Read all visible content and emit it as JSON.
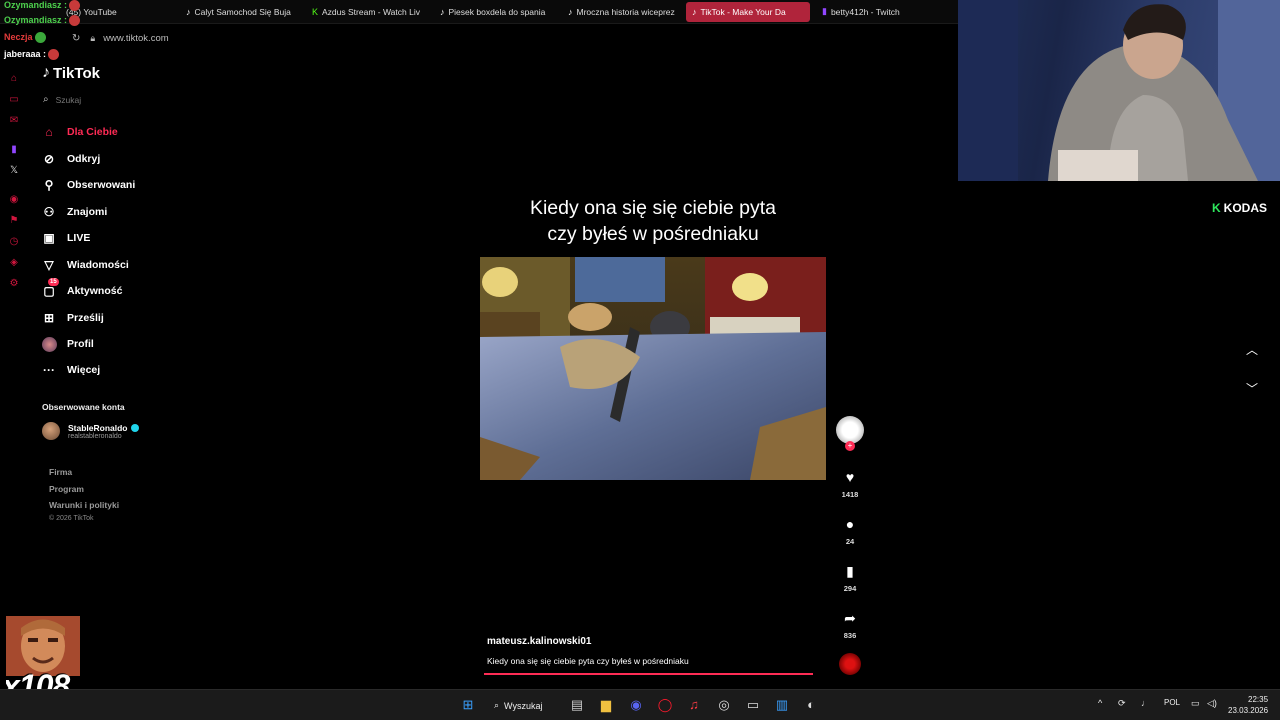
{
  "browser": {
    "tabs": [
      {
        "label": "(45) YouTube",
        "active": false
      },
      {
        "label": "Calyt Samochod Się Buja",
        "active": false
      },
      {
        "label": "Azdus Stream - Watch Liv",
        "active": false
      },
      {
        "label": "Piesek boxdela do spania",
        "active": false
      },
      {
        "label": "Mroczna historia wiceprez",
        "active": false
      },
      {
        "label": "TikTok - Make Your Da",
        "active": true
      },
      {
        "label": "betty412h - Twitch",
        "active": false
      }
    ],
    "url": "www.tiktok.com"
  },
  "chat_overlay": {
    "lines": [
      {
        "user": "Ozymandiasz :",
        "color": "#4dd04d"
      },
      {
        "user": "Ozymandiasz :",
        "color": "#4dd04d"
      },
      {
        "user": "Neczja",
        "color": "#e33c3c"
      },
      {
        "user": "jaberaaa :",
        "color": "#ffffff"
      }
    ]
  },
  "sidebar": {
    "logo": "TikTok",
    "search_placeholder": "Szukaj",
    "nav": [
      {
        "label": "Dla Ciebie",
        "icon": "home-icon",
        "active": true
      },
      {
        "label": "Odkryj",
        "icon": "compass-icon"
      },
      {
        "label": "Obserwowani",
        "icon": "following-icon"
      },
      {
        "label": "Znajomi",
        "icon": "friends-icon"
      },
      {
        "label": "LIVE",
        "icon": "live-icon"
      },
      {
        "label": "Wiadomości",
        "icon": "messages-icon"
      },
      {
        "label": "Aktywność",
        "icon": "activity-icon",
        "badge": "15"
      },
      {
        "label": "Prześlij",
        "icon": "upload-icon"
      },
      {
        "label": "Profil",
        "icon": "profile-icon"
      },
      {
        "label": "Więcej",
        "icon": "more-icon"
      }
    ],
    "followed_title": "Obserwowane konta",
    "followed": [
      {
        "name": "StableRonaldo",
        "handle": "realstableronaldo",
        "verified": true
      }
    ],
    "footer_links": [
      "Firma",
      "Program",
      "Warunki i polityki"
    ],
    "copyright": "© 2026 TikTok"
  },
  "video": {
    "caption_line1": "Kiedy ona się się ciebie pyta",
    "caption_line2": "czy byłeś w pośredniaku",
    "author": "mateusz.kalinowski01",
    "description": "Kiedy ona się się ciebie pyta czy byłeś w pośredniaku",
    "progress": 1.0,
    "likes": "1418",
    "comments": "24",
    "saves": "294",
    "shares": "836",
    "accent": "#fe2c55"
  },
  "overlay": {
    "kodas": "KODAS",
    "emote_counter": "x108"
  },
  "taskbar": {
    "search_label": "Wyszukaj",
    "language": "POL",
    "time": "22:35",
    "date": "23.03.2026"
  }
}
